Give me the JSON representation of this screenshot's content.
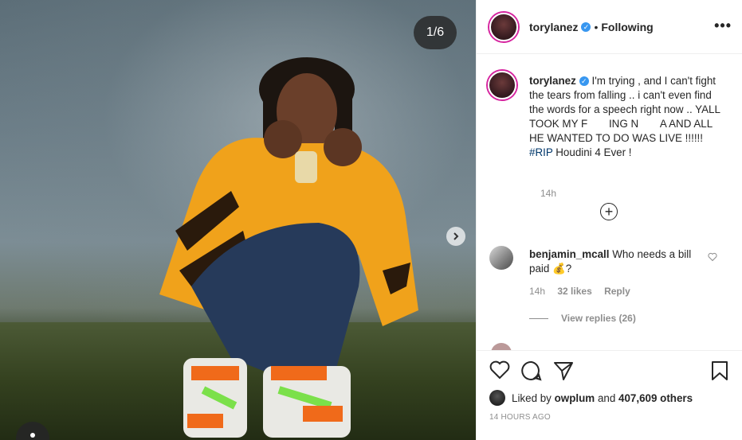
{
  "post": {
    "counter": "1/6",
    "username": "torylanez",
    "separator": "•",
    "follow_status": "Following",
    "more": "•••"
  },
  "caption": {
    "username": "torylanez",
    "text_before_hashtag": "I'm trying , and I can't fight the tears from falling .. i can't even find the words for a speech right now .. YALL TOOK MY F  ING N  A AND ALL HE WANTED TO DO WAS LIVE !!!!!! ",
    "hashtag": "#RIP",
    "text_after_hashtag": " Houdini 4 Ever !",
    "time": "14h"
  },
  "comment": {
    "username": "benjamin_mcall",
    "text": "Who needs a bill paid 💰?",
    "time": "14h",
    "likes": "32 likes",
    "reply": "Reply",
    "view_replies": "View replies (26)"
  },
  "likes": {
    "prefix": "Liked by",
    "user": "owplum",
    "and": "and",
    "others": "407,609 others"
  },
  "timestamp": "14 HOURS AGO",
  "icons": [
    "verified-icon",
    "more-icon",
    "plus-circle-icon",
    "heart-icon",
    "comment-icon",
    "share-icon",
    "bookmark-icon",
    "chevron-right-icon"
  ],
  "colors": {
    "verified": "#3897f0",
    "hashtag": "#00376b",
    "muted": "#8e8e8e",
    "ring": "#d6249f"
  }
}
